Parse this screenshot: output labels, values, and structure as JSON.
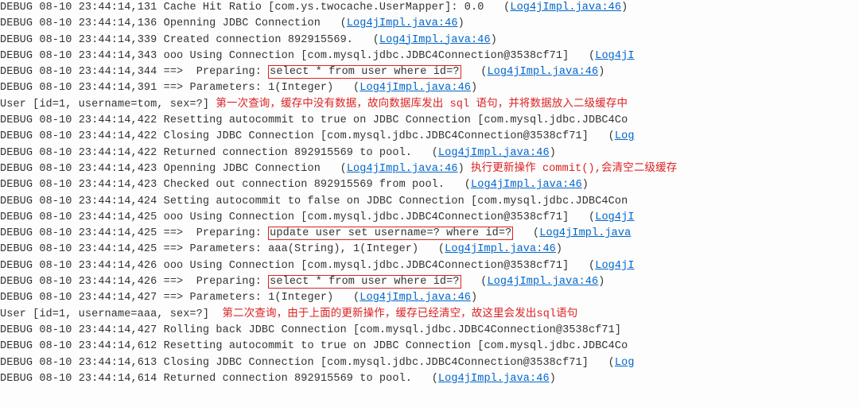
{
  "level": "DEBUG",
  "date": "08-10",
  "time": "23:44:14",
  "src": "Log4jImpl.java:46",
  "msg": {
    "cache_hit_ratio": "Cache Hit Ratio [com.ys.twocache.UserMapper]: 0.0",
    "openning_jdbc": "Openning JDBC Connection",
    "created_conn": "Created connection 892915569.",
    "using_conn": "ooo Using Connection [com.mysql.jdbc.JDBC4Connection@3538cf71]",
    "preparing_prefix": "==>  Preparing: ",
    "select_user": "select * from user where id=?",
    "params_1int": "==> Parameters: 1(Integer)",
    "user_tom": "User [id=1, username=tom, sex=?]",
    "resetting": "Resetting autocommit to true on JDBC Connection [com.mysql.jdbc.JDBC4Co",
    "closing": "Closing JDBC Connection [com.mysql.jdbc.JDBC4Connection@3538cf71]",
    "ret_pool": "Returned connection 892915569 to pool.",
    "checked_out": "Checked out connection 892915569 from pool.",
    "setting_false": "Setting autocommit to false on JDBC Connection [com.mysql.jdbc.JDBC4Con",
    "update_user": "update user set username=? where id=?",
    "params_aaa": "==> Parameters: aaa(String), 1(Integer)",
    "user_aaa": "User [id=1, username=aaa, sex=?]",
    "rolling_back": "Rolling back JDBC Connection [com.mysql.jdbc.JDBC4Connection@3538cf71]"
  },
  "ms": {
    "l0": "131",
    "l1": "136",
    "l2": "339",
    "l3": "343",
    "l4": "344",
    "l5": "391",
    "l7": "422",
    "l8": "422",
    "l9": "422",
    "l10": "423",
    "l11": "423",
    "l12": "424",
    "l13": "425",
    "l14": "425",
    "l15": "425",
    "l16": "426",
    "l17": "426",
    "l18": "427",
    "l20": "427",
    "l21": "612",
    "l22": "613",
    "l23": "614"
  },
  "ann": {
    "first_query": "第一次查询，缓存中没有数据，故向数据库发出 sql 语句，并将数据放入二级缓存中",
    "commit_clear": "执行更新操作 commit(),会清空二级缓存",
    "second_query": "第二次查询，由于上面的更新操作，缓存已经清空，故这里会发出sql语句"
  },
  "link_short": {
    "log4ji": "Log4jI",
    "log4jimpl_java": "Log4jImpl.java",
    "log": "Log"
  },
  "paren": {
    "open": "   (",
    "close": ")"
  }
}
